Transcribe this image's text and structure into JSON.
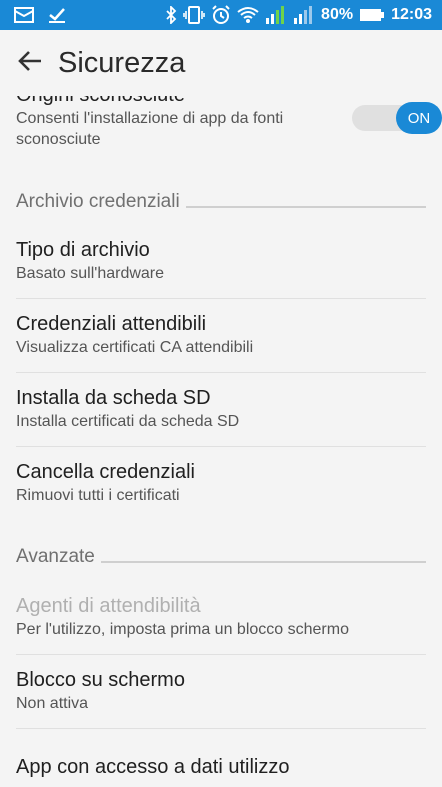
{
  "status_bar": {
    "battery_percent": "80%",
    "time": "12:03",
    "icons": [
      "message-icon",
      "download-done-icon",
      "bluetooth-icon",
      "vibrate-icon",
      "alarm-icon",
      "wifi-icon",
      "signal-icon",
      "signal-icon-2",
      "battery-icon"
    ]
  },
  "app_bar": {
    "title": "Sicurezza"
  },
  "items": {
    "unknown_sources": {
      "title": "Origini sconosciute",
      "subtitle": "Consenti l'installazione di app da fonti sconosciute",
      "toggle_label": "ON"
    },
    "credential_storage_section": "Archivio credenziali",
    "storage_type": {
      "title": "Tipo di archivio",
      "subtitle": "Basato sull'hardware"
    },
    "trusted_credentials": {
      "title": "Credenziali attendibili",
      "subtitle": "Visualizza certificati CA attendibili"
    },
    "install_from_sd": {
      "title": "Installa da scheda SD",
      "subtitle": "Installa certificati da scheda SD"
    },
    "clear_credentials": {
      "title": "Cancella credenziali",
      "subtitle": "Rimuovi tutti i certificati"
    },
    "advanced_section": "Avanzate",
    "trust_agents": {
      "title": "Agenti di attendibilità",
      "subtitle": "Per l'utilizzo, imposta prima un blocco schermo"
    },
    "screen_pinning": {
      "title": "Blocco su schermo",
      "subtitle": "Non attiva"
    },
    "usage_access": {
      "title": "App con accesso a dati utilizzo"
    }
  },
  "colors": {
    "accent": "#1a89d6",
    "background": "#f4f4f4"
  }
}
